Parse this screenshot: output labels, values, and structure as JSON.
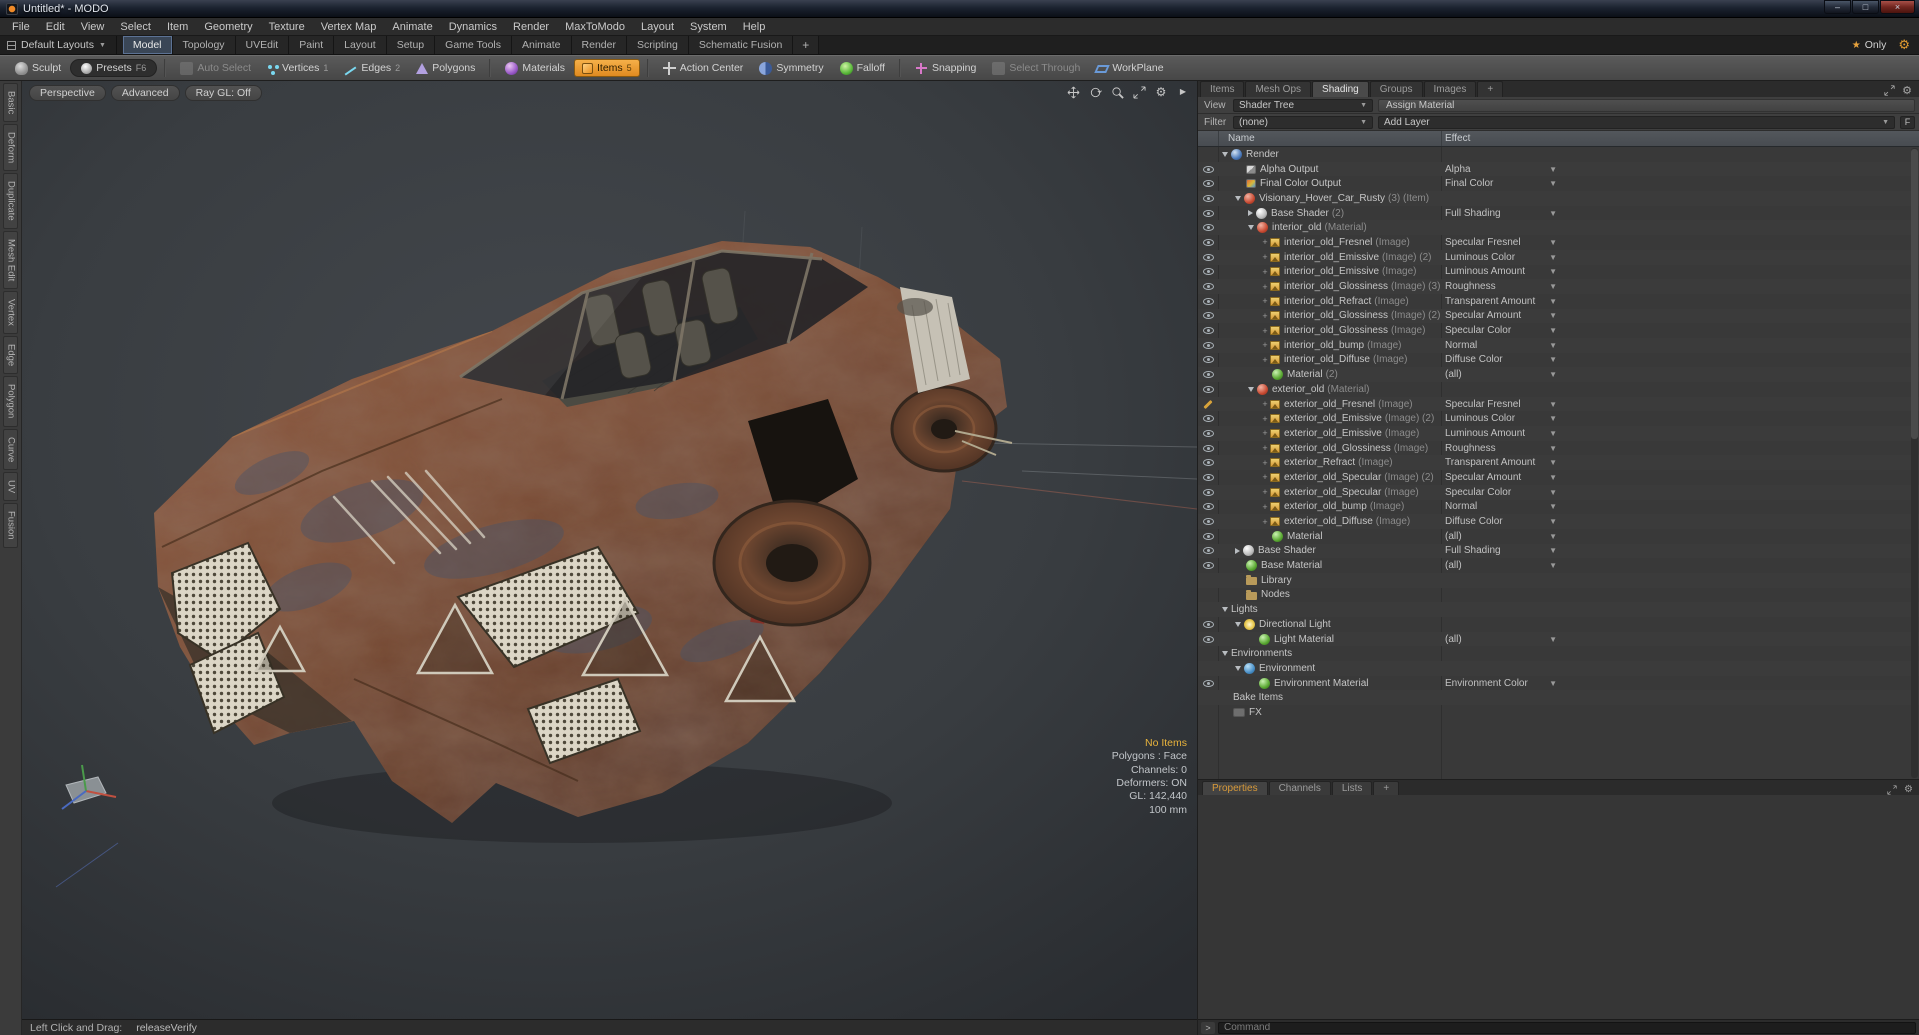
{
  "window": {
    "title": "Untitled* - MODO"
  },
  "titlebar": {
    "minimize": "–",
    "maximize": "□",
    "close": "×"
  },
  "menubar": [
    "File",
    "Edit",
    "View",
    "Select",
    "Item",
    "Geometry",
    "Texture",
    "Vertex Map",
    "Animate",
    "Dynamics",
    "Render",
    "MaxToModo",
    "Layout",
    "System",
    "Help"
  ],
  "layout_row": {
    "default_layouts": "Default Layouts",
    "tabs": [
      "Model",
      "Topology",
      "UVEdit",
      "Paint",
      "Layout",
      "Setup",
      "Game Tools",
      "Animate",
      "Render",
      "Scripting",
      "Schematic Fusion"
    ],
    "active_tab": "Model",
    "add_tab": "+",
    "star": "★",
    "only": "Only"
  },
  "toolbar": {
    "groups": [
      {
        "buttons": [
          {
            "label": "Sculpt",
            "icon": "sculpt-icon"
          },
          {
            "label": "Presets",
            "key": "F6",
            "icon": "presets-icon",
            "style": "dark"
          }
        ]
      },
      {
        "buttons": [
          {
            "label": "Auto Select",
            "icon": "auto-select-icon",
            "disabled": true
          },
          {
            "label": "Vertices",
            "key": "1",
            "icon": "vertices-icon"
          },
          {
            "label": "Edges",
            "key": "2",
            "icon": "edges-icon"
          },
          {
            "label": "Polygons",
            "icon": "polygons-icon"
          }
        ]
      },
      {
        "buttons": [
          {
            "label": "Materials",
            "icon": "materials-icon"
          },
          {
            "label": "Items",
            "key": "5",
            "icon": "items-icon",
            "active": true
          }
        ]
      },
      {
        "buttons": [
          {
            "label": "Action Center",
            "icon": "action-center-icon"
          },
          {
            "label": "Symmetry",
            "icon": "symmetry-icon"
          },
          {
            "label": "Falloff",
            "icon": "falloff-icon"
          }
        ]
      },
      {
        "buttons": [
          {
            "label": "Snapping",
            "icon": "snapping-icon"
          },
          {
            "label": "Select Through",
            "icon": "select-through-icon",
            "disabled": true
          },
          {
            "label": "WorkPlane",
            "icon": "workplane-icon"
          }
        ]
      }
    ]
  },
  "left_tabs": [
    "Basic",
    "Deform",
    "Duplicate",
    "Mesh Edit",
    "Vertex",
    "Edge",
    "Polygon",
    "Curve",
    "UV",
    "Fusion"
  ],
  "viewport": {
    "buttons": [
      "Perspective",
      "Advanced",
      "Ray GL: Off"
    ],
    "tools": [
      "pan-icon",
      "orbit-icon",
      "zoom-icon",
      "maximize-icon",
      "gear-icon",
      "play-icon"
    ],
    "info": [
      {
        "text": "No Items",
        "highlight": true
      },
      {
        "text": "Polygons : Face"
      },
      {
        "text": "Channels: 0"
      },
      {
        "text": "Deformers: ON"
      },
      {
        "text": "GL: 142,440"
      },
      {
        "text": "100 mm"
      }
    ]
  },
  "statusbar": {
    "label": "Left Click and Drag:",
    "value": "releaseVerify"
  },
  "right_panel": {
    "tabs": [
      "Items",
      "Mesh Ops",
      "Shading",
      "Groups",
      "Images"
    ],
    "active_tab": "Shading",
    "add_tab": "+",
    "view_label": "View",
    "view_value": "Shader Tree",
    "assign_material": "Assign Material",
    "filter_label": "Filter",
    "filter_value": "(none)",
    "add_layer": "Add Layer",
    "f_button": "F",
    "columns": {
      "name": "Name",
      "effect": "Effect"
    },
    "rows": [
      {
        "eye": null,
        "indent": 0,
        "arrow": "down",
        "plus": false,
        "icon": "render-sphere",
        "label": "Render",
        "suffix": "",
        "effect": "",
        "dropdown": false
      },
      {
        "eye": "eye",
        "indent": 1,
        "arrow": null,
        "plus": false,
        "icon": "alpha-output",
        "label": "Alpha Output",
        "suffix": "",
        "effect": "Alpha",
        "dropdown": true
      },
      {
        "eye": "eye",
        "indent": 1,
        "arrow": null,
        "plus": false,
        "icon": "color-output",
        "label": "Final Color Output",
        "suffix": "",
        "effect": "Final Color",
        "dropdown": true
      },
      {
        "eye": "eye",
        "indent": 1,
        "arrow": "down",
        "plus": false,
        "icon": "item-sphere-red",
        "label": "Visionary_Hover_Car_Rusty",
        "suffix": "(3) (Item)",
        "effect": "",
        "dropdown": false
      },
      {
        "eye": "eye",
        "indent": 2,
        "arrow": "right",
        "plus": false,
        "icon": "shader-ball",
        "label": "Base Shader",
        "suffix": "(2)",
        "effect": "Full Shading",
        "dropdown": true
      },
      {
        "eye": "eye",
        "indent": 2,
        "arrow": "down",
        "plus": false,
        "icon": "material-sphere-red",
        "label": "interior_old",
        "suffix": "(Material)",
        "effect": "",
        "dropdown": false
      },
      {
        "eye": "eye",
        "indent": 3,
        "arrow": null,
        "plus": true,
        "icon": "image-layer",
        "label": "interior_old_Fresnel",
        "suffix": "(Image)",
        "effect": "Specular Fresnel",
        "dropdown": true
      },
      {
        "eye": "eye",
        "indent": 3,
        "arrow": null,
        "plus": true,
        "icon": "image-layer",
        "label": "interior_old_Emissive",
        "suffix": "(Image) (2)",
        "effect": "Luminous Color",
        "dropdown": true
      },
      {
        "eye": "eye",
        "indent": 3,
        "arrow": null,
        "plus": true,
        "icon": "image-layer",
        "label": "interior_old_Emissive",
        "suffix": "(Image)",
        "effect": "Luminous Amount",
        "dropdown": true
      },
      {
        "eye": "eye",
        "indent": 3,
        "arrow": null,
        "plus": true,
        "icon": "image-layer",
        "label": "interior_old_Glossiness",
        "suffix": "(Image) (3)",
        "effect": "Roughness",
        "dropdown": true
      },
      {
        "eye": "eye",
        "indent": 3,
        "arrow": null,
        "plus": true,
        "icon": "image-layer",
        "label": "interior_old_Refract",
        "suffix": "(Image)",
        "effect": "Transparent Amount",
        "dropdown": true
      },
      {
        "eye": "eye",
        "indent": 3,
        "arrow": null,
        "plus": true,
        "icon": "image-layer",
        "label": "interior_old_Glossiness",
        "suffix": "(Image) (2)",
        "effect": "Specular Amount",
        "dropdown": true
      },
      {
        "eye": "eye",
        "indent": 3,
        "arrow": null,
        "plus": true,
        "icon": "image-layer",
        "label": "interior_old_Glossiness",
        "suffix": "(Image)",
        "effect": "Specular Color",
        "dropdown": true
      },
      {
        "eye": "eye",
        "indent": 3,
        "arrow": null,
        "plus": true,
        "icon": "image-layer",
        "label": "interior_old_bump",
        "suffix": "(Image)",
        "effect": "Normal",
        "dropdown": true
      },
      {
        "eye": "eye",
        "indent": 3,
        "arrow": null,
        "plus": true,
        "icon": "image-layer",
        "label": "interior_old_Diffuse",
        "suffix": "(Image)",
        "effect": "Diffuse Color",
        "dropdown": true
      },
      {
        "eye": "eye",
        "indent": 3,
        "arrow": null,
        "plus": false,
        "icon": "material-sphere-green",
        "label": "Material",
        "suffix": "(2)",
        "effect": "(all)",
        "dropdown": true
      },
      {
        "eye": "eye",
        "indent": 2,
        "arrow": "down",
        "plus": false,
        "icon": "material-sphere-red",
        "label": "exterior_old",
        "suffix": "(Material)",
        "effect": "",
        "dropdown": false
      },
      {
        "eye": "pencil",
        "indent": 3,
        "arrow": null,
        "plus": true,
        "icon": "image-layer",
        "label": "exterior_old_Fresnel",
        "suffix": "(Image)",
        "effect": "Specular Fresnel",
        "dropdown": true
      },
      {
        "eye": "eye",
        "indent": 3,
        "arrow": null,
        "plus": true,
        "icon": "image-layer",
        "label": "exterior_old_Emissive",
        "suffix": "(Image) (2)",
        "effect": "Luminous Color",
        "dropdown": true
      },
      {
        "eye": "eye",
        "indent": 3,
        "arrow": null,
        "plus": true,
        "icon": "image-layer",
        "label": "exterior_old_Emissive",
        "suffix": "(Image)",
        "effect": "Luminous Amount",
        "dropdown": true
      },
      {
        "eye": "eye",
        "indent": 3,
        "arrow": null,
        "plus": true,
        "icon": "image-layer",
        "label": "exterior_old_Glossiness",
        "suffix": "(Image)",
        "effect": "Roughness",
        "dropdown": true
      },
      {
        "eye": "eye",
        "indent": 3,
        "arrow": null,
        "plus": true,
        "icon": "image-layer",
        "label": "exterior_Refract",
        "suffix": "(Image)",
        "effect": "Transparent Amount",
        "dropdown": true
      },
      {
        "eye": "eye",
        "indent": 3,
        "arrow": null,
        "plus": true,
        "icon": "image-layer",
        "label": "exterior_old_Specular",
        "suffix": "(Image) (2)",
        "effect": "Specular Amount",
        "dropdown": true
      },
      {
        "eye": "eye",
        "indent": 3,
        "arrow": null,
        "plus": true,
        "icon": "image-layer",
        "label": "exterior_old_Specular",
        "suffix": "(Image)",
        "effect": "Specular Color",
        "dropdown": true
      },
      {
        "eye": "eye",
        "indent": 3,
        "arrow": null,
        "plus": true,
        "icon": "image-layer",
        "label": "exterior_old_bump",
        "suffix": "(Image)",
        "effect": "Normal",
        "dropdown": true
      },
      {
        "eye": "eye",
        "indent": 3,
        "arrow": null,
        "plus": true,
        "icon": "image-layer",
        "label": "exterior_old_Diffuse",
        "suffix": "(Image)",
        "effect": "Diffuse Color",
        "dropdown": true
      },
      {
        "eye": "eye",
        "indent": 3,
        "arrow": null,
        "plus": false,
        "icon": "material-sphere-green",
        "label": "Material",
        "suffix": "",
        "effect": "(all)",
        "dropdown": true
      },
      {
        "eye": "eye",
        "indent": 1,
        "arrow": "right",
        "plus": false,
        "icon": "shader-ball",
        "label": "Base Shader",
        "suffix": "",
        "effect": "Full Shading",
        "dropdown": true
      },
      {
        "eye": "eye",
        "indent": 1,
        "arrow": null,
        "plus": false,
        "icon": "material-sphere-green",
        "label": "Base Material",
        "suffix": "",
        "effect": "(all)",
        "dropdown": true
      },
      {
        "eye": null,
        "indent": 1,
        "arrow": null,
        "plus": false,
        "icon": "folder",
        "label": "Library",
        "suffix": "",
        "effect": "",
        "dropdown": false
      },
      {
        "eye": null,
        "indent": 1,
        "arrow": null,
        "plus": false,
        "icon": "folder",
        "label": "Nodes",
        "suffix": "",
        "effect": "",
        "dropdown": false
      },
      {
        "eye": null,
        "indent": 0,
        "arrow": "down",
        "plus": false,
        "icon": null,
        "label": "Lights",
        "suffix": "",
        "effect": "",
        "dropdown": false
      },
      {
        "eye": "eye",
        "indent": 1,
        "arrow": "down",
        "plus": false,
        "icon": "light-item",
        "label": "Directional Light",
        "suffix": "",
        "effect": "",
        "dropdown": false
      },
      {
        "eye": "eye",
        "indent": 2,
        "arrow": null,
        "plus": false,
        "icon": "material-sphere-green",
        "label": "Light Material",
        "suffix": "",
        "effect": "(all)",
        "dropdown": true
      },
      {
        "eye": null,
        "indent": 0,
        "arrow": "down",
        "plus": false,
        "icon": null,
        "label": "Environments",
        "suffix": "",
        "effect": "",
        "dropdown": false
      },
      {
        "eye": null,
        "indent": 1,
        "arrow": "down",
        "plus": false,
        "icon": "environment-item",
        "label": "Environment",
        "suffix": "",
        "effect": "",
        "dropdown": false
      },
      {
        "eye": "eye",
        "indent": 2,
        "arrow": null,
        "plus": false,
        "icon": "material-sphere-green",
        "label": "Environment Material",
        "suffix": "",
        "effect": "Environment Color",
        "dropdown": true
      },
      {
        "eye": null,
        "indent": 0,
        "arrow": null,
        "plus": false,
        "icon": null,
        "label": "Bake Items",
        "suffix": "",
        "effect": "",
        "dropdown": false
      },
      {
        "eye": null,
        "indent": 0,
        "arrow": null,
        "plus": false,
        "icon": "fx",
        "label": "FX",
        "suffix": "",
        "effect": "",
        "dropdown": false
      }
    ],
    "bottom_tabs": [
      "Properties",
      "Channels",
      "Lists"
    ],
    "bottom_add": "+",
    "command_prompt": ">",
    "command_placeholder": "Command"
  },
  "colors": {
    "accent_orange": "#e8962e",
    "highlight_yellow": "#e8b33c",
    "rust_body": "#7a482f"
  }
}
